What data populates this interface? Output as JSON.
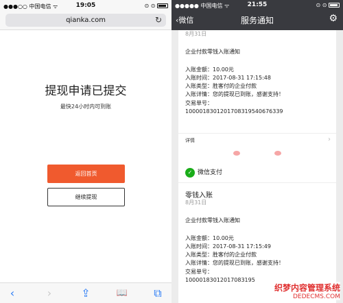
{
  "left": {
    "status": {
      "carrier": "●●●○○ 中国电信 ᯤ",
      "time": "19:05",
      "right": "⊙ ⊙"
    },
    "url": "qianka.com",
    "title": "提现申请已提交",
    "subtitle": "最快24小时内可到账",
    "primary_button": "返回首页",
    "secondary_button": "继续提现",
    "toolbar": {
      "back": "‹",
      "forward": "›",
      "share": "⇪",
      "bookmarks": "📖",
      "tabs": "⧉"
    }
  },
  "right": {
    "status": {
      "carrier": "●●●●● 中国电信 ᯤ",
      "time": "21:55",
      "right": "⊙ ⊙"
    },
    "nav": {
      "back": "‹微信",
      "title": "服务通知",
      "settings": "⚙"
    },
    "card1": {
      "date": "8月31日",
      "lines": [
        "企业付款零钱入账通知",
        "入账金额：10.00元",
        "入账时间：2017-08-31 17:15:48",
        "入账类型：胜客付的企业付款",
        "入账详情：您的提现已到账，感谢支持！",
        "交易单号：",
        "1000018301201708319540676339"
      ],
      "footer": "详情"
    },
    "card2": {
      "header": "微信支付",
      "heading": "零钱入账",
      "date": "8月31日",
      "lines": [
        "企业付款零钱入账通知",
        "入账金额：10.00元",
        "入账时间：2017-08-31 17:15:49",
        "入账类型：胜客付的企业付款",
        "入账详情：您的提现已到账，感谢支持！",
        "交易单号：",
        "10000183012017083195"
      ]
    },
    "watermark": {
      "line1": "织梦内容管理系统",
      "line2": "DEDECMS.COM"
    }
  }
}
